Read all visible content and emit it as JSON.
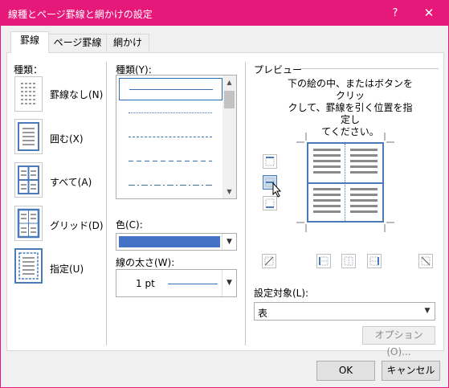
{
  "window": {
    "title": "線種とページ罫線と網かけの設定",
    "help_label": "?",
    "close_label": "✕"
  },
  "tabs": [
    {
      "label": "罫線",
      "active": true
    },
    {
      "label": "ページ罫線",
      "active": false
    },
    {
      "label": "網かけ",
      "active": false
    }
  ],
  "settings": {
    "heading": "種類：",
    "items": [
      {
        "label": "罫線なし(N)",
        "mnemonic": "N",
        "icon": "no-border-icon"
      },
      {
        "label": "囲む(X)",
        "mnemonic": "X",
        "icon": "box-border-icon"
      },
      {
        "label": "すべて(A)",
        "mnemonic": "A",
        "icon": "all-borders-icon"
      },
      {
        "label": "グリッド(D)",
        "mnemonic": "D",
        "icon": "grid-border-icon"
      },
      {
        "label": "指定(U)",
        "mnemonic": "U",
        "icon": "custom-border-icon",
        "selected": true
      }
    ]
  },
  "style": {
    "heading": "種類(Y):",
    "styles": [
      "solid",
      "dotted",
      "small-dashed",
      "dashed",
      "dash-dot"
    ],
    "selected_index": 0
  },
  "color": {
    "label": "色(C):",
    "value": "#4472c4"
  },
  "width": {
    "label": "線の太さ(W):",
    "value": "1 pt"
  },
  "preview": {
    "heading": "プレビュー",
    "instructions": [
      "下の絵の中、またはボタンをクリッ",
      "クして、罫線を引く位置を指定し",
      "てください。"
    ]
  },
  "apply_to": {
    "label": "設定対象(L):",
    "value": "表"
  },
  "buttons": {
    "options": "オプション(O)...",
    "ok": "OK",
    "cancel": "キャンセル"
  },
  "colors": {
    "accent": "#e6197a",
    "border_blue": "#4b7ab8",
    "line_blue": "#3a6fb1"
  }
}
